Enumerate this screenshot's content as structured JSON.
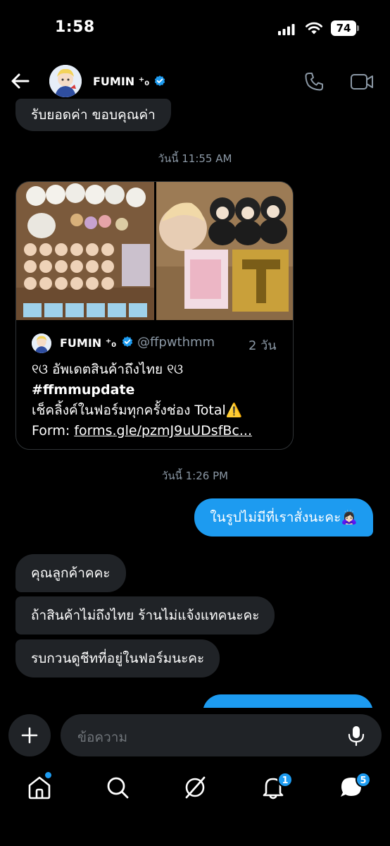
{
  "status_bar": {
    "time": "1:58",
    "battery": "74"
  },
  "header": {
    "name": "FUMIN ⁺₀",
    "verified": true
  },
  "messages": [
    {
      "side": "in",
      "text": "รับยอดค่า ขอบคุณค่า"
    },
    {
      "side": "out",
      "text": "ในรูปไม่มีที่เราสั่งนะคะ🙇🏻‍♀️"
    },
    {
      "side": "in",
      "text": "คุณลูกค้าคคะ"
    },
    {
      "side": "in",
      "text": "ถ้าสินค้าไม่ถึงไทย ร้านไม่แจ้งแทคนะคะ"
    },
    {
      "side": "in",
      "text": "รบกวนดูชีทที่อยู่ในฟอร์มนะคะ"
    }
  ],
  "timestamps": [
    "วันนี้ 11:55 AM",
    "วันนี้ 1:26 PM"
  ],
  "shared_post": {
    "author": "FUMIN ⁺₀",
    "handle": "@ffpwthmm",
    "age": "2 วัน",
    "line1": "୧ଓ อัพเดตสินค้าถึงไทย ୧ଓ",
    "hashtag": "#ffmmupdate",
    "line3": "เช็คลิ้งค์ในฟอร์มทุกครั้งช่อง Total⚠️",
    "form_label": "Form: ",
    "form_link": "forms.gle/pzmJ9uUDsfBc..."
  },
  "composer": {
    "placeholder": "ข้อความ"
  },
  "nav": {
    "items": [
      "home",
      "search",
      "grok",
      "notifications",
      "messages"
    ],
    "notifications_badge": "1",
    "messages_badge": "5"
  },
  "colors": {
    "accent": "#1d9bf0",
    "incoming_bubble": "#202327",
    "muted": "#8b98a5"
  }
}
